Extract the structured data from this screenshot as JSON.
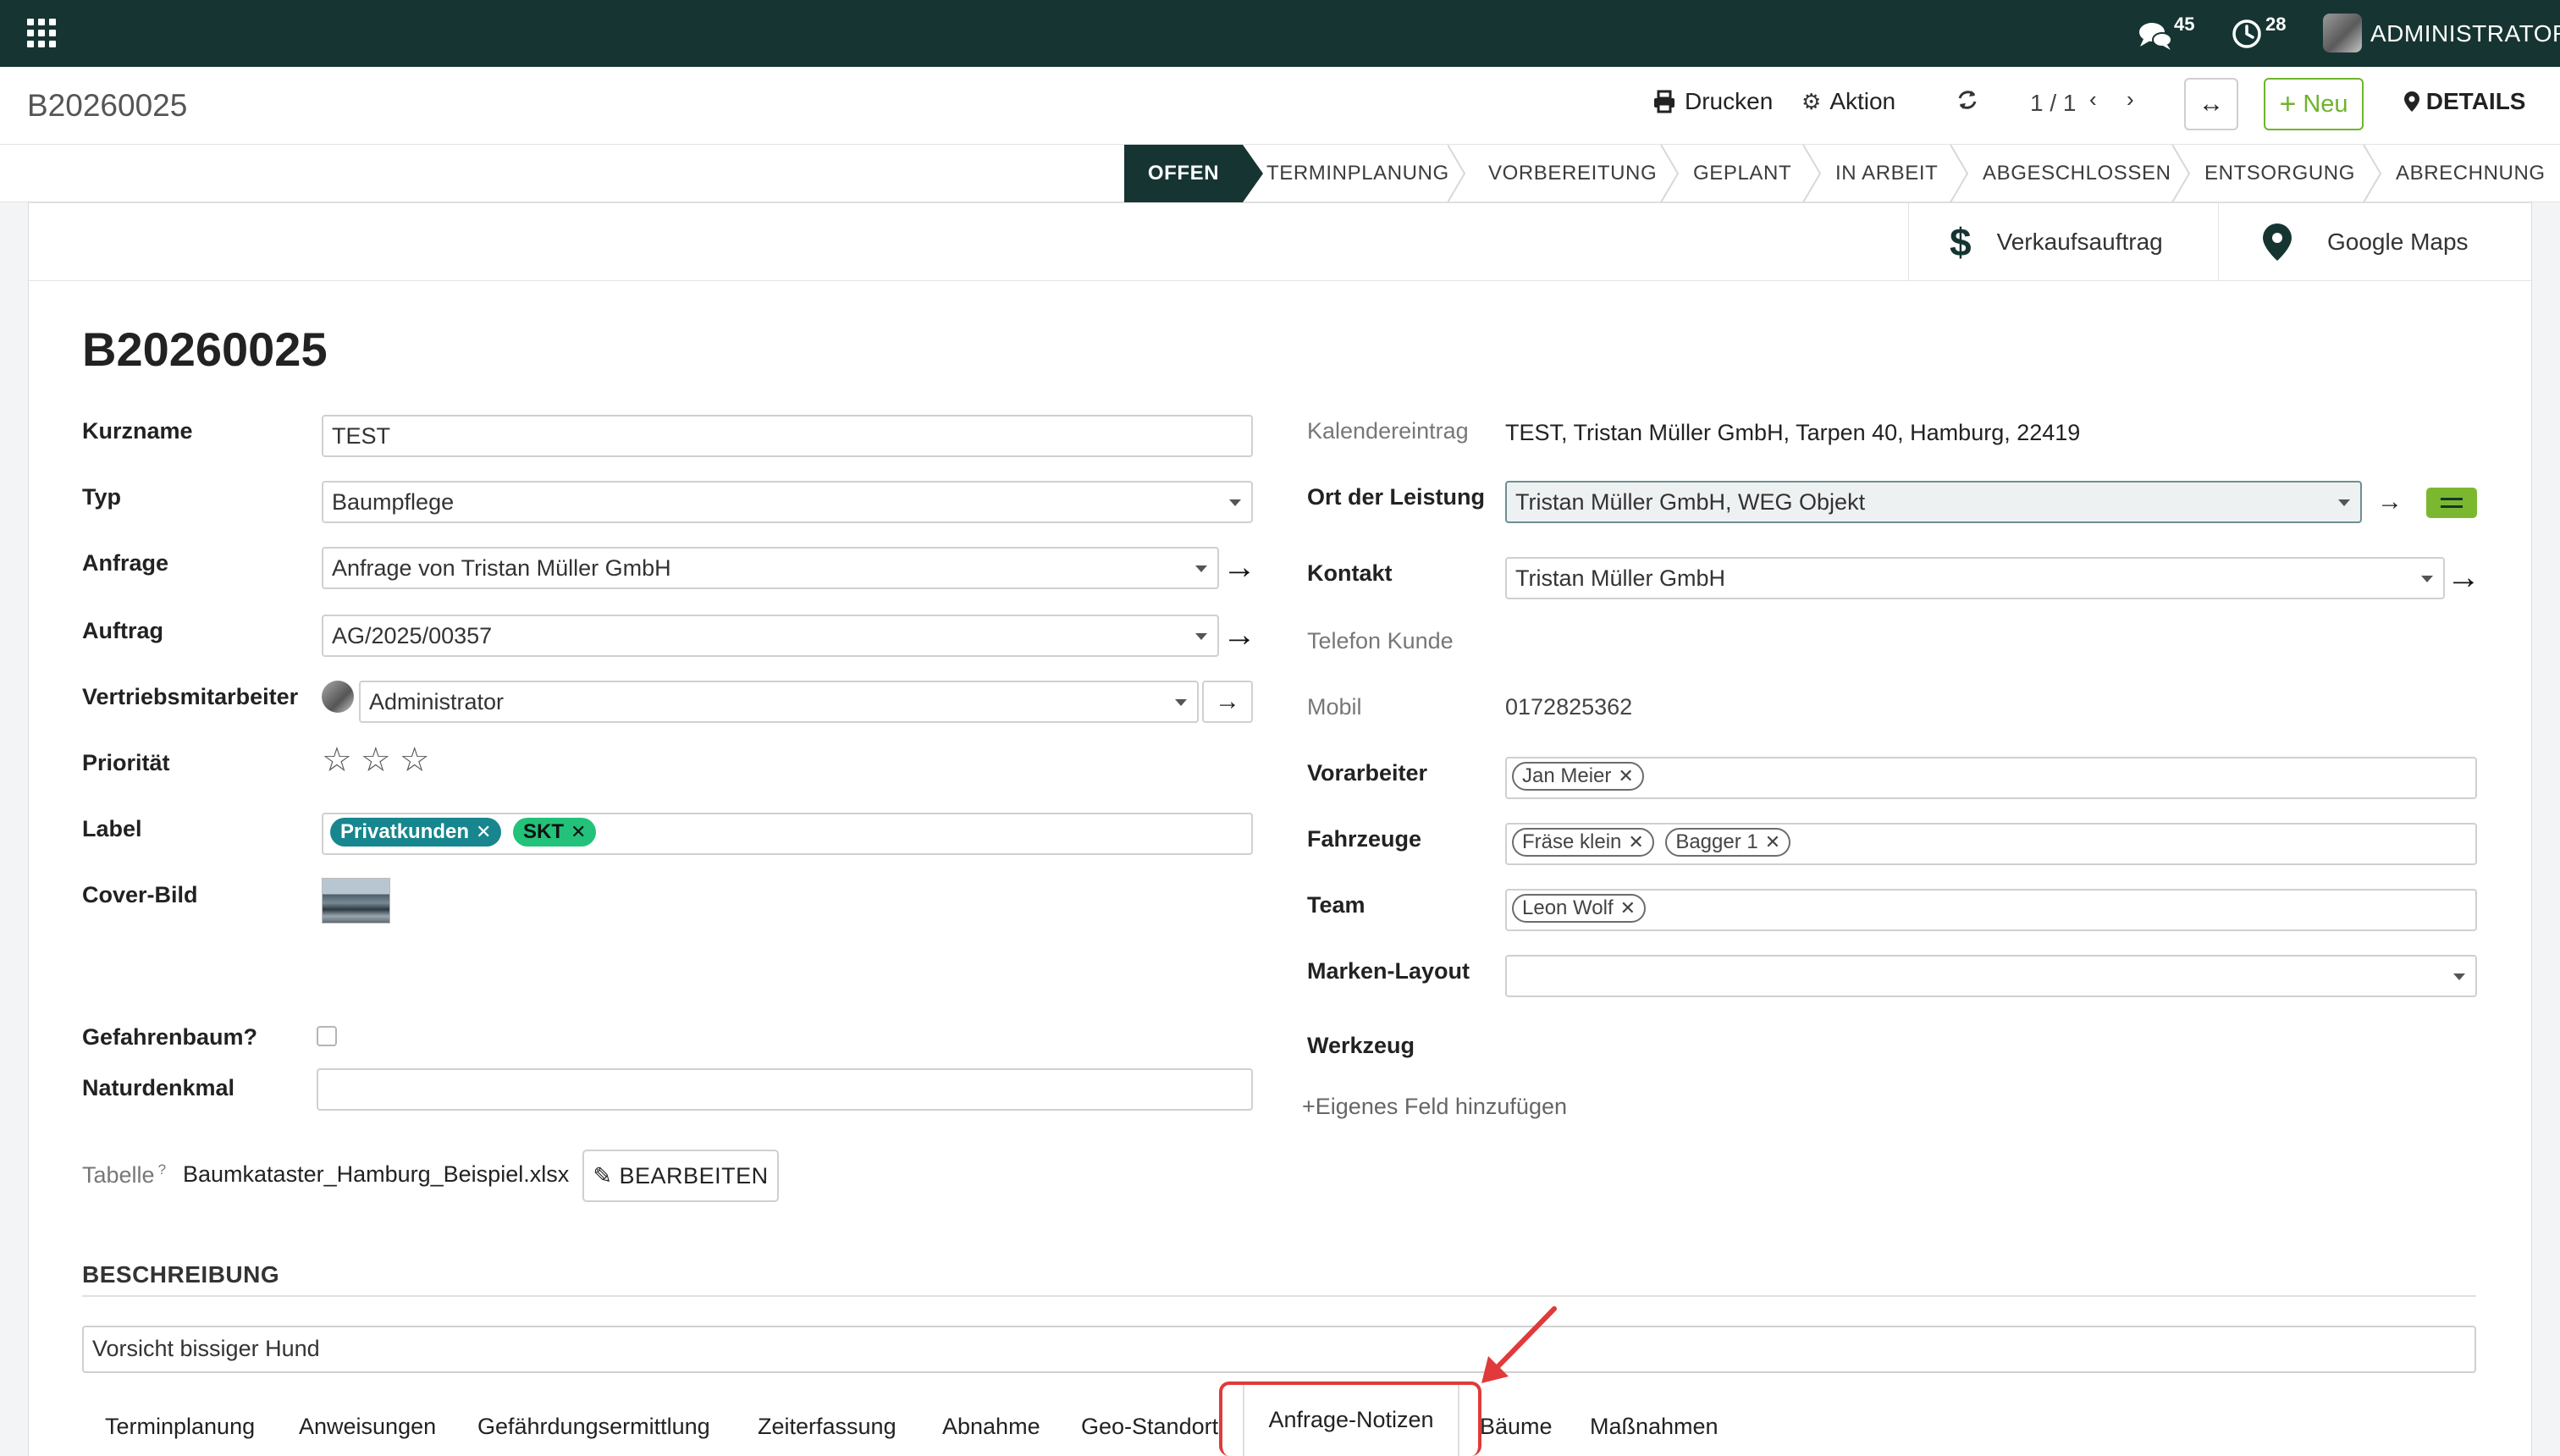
{
  "navbar": {
    "messages_count": "45",
    "activities_count": "28",
    "user_name": "ADMINISTRATOR"
  },
  "control_panel": {
    "record_name": "B20260025",
    "print_label": "Drucken",
    "action_label": "Aktion",
    "pager_value": "1 / 1",
    "new_label": "Neu",
    "details_label": "DETAILS"
  },
  "statusbar": {
    "stages": [
      "OFFEN",
      "TERMINPLANUNG",
      "VORBEREITUNG",
      "GEPLANT",
      "IN ARBEIT",
      "ABGESCHLOSSEN",
      "ENTSORGUNG",
      "ABRECHNUNG"
    ],
    "active_stage": "OFFEN"
  },
  "smart_buttons": {
    "sales_order_label": "Verkaufsauftrag",
    "google_maps_label": "Google Maps"
  },
  "form": {
    "title": "B20260025",
    "left": {
      "kurzname_label": "Kurzname",
      "kurzname_value": "TEST",
      "typ_label": "Typ",
      "typ_value": "Baumpflege",
      "anfrage_label": "Anfrage",
      "anfrage_value": "Anfrage von Tristan Müller GmbH",
      "auftrag_label": "Auftrag",
      "auftrag_value": "AG/2025/00357",
      "vertrieb_label": "Vertriebsmitarbeiter",
      "vertrieb_value": "Administrator",
      "prioritaet_label": "Priorität",
      "prioritaet_stars": 0,
      "label_label": "Label",
      "label_tags": [
        "Privatkunden",
        "SKT"
      ],
      "cover_label": "Cover-Bild",
      "gefahrenbaum_label": "Gefahrenbaum?",
      "gefahrenbaum_checked": false,
      "naturdenkmal_label": "Naturdenkmal",
      "naturdenkmal_value": "",
      "tabelle_label": "Tabelle",
      "tabelle_help": "?",
      "tabelle_value": "Baumkataster_Hamburg_Beispiel.xlsx",
      "bearbeiten_label": "BEARBEITEN"
    },
    "right": {
      "kalender_label": "Kalendereintrag",
      "kalender_value": "TEST, Tristan Müller GmbH, Tarpen 40, Hamburg, 22419",
      "ort_label": "Ort der Leistung",
      "ort_value": "Tristan Müller GmbH, WEG Objekt",
      "kontakt_label": "Kontakt",
      "kontakt_value": "Tristan Müller GmbH",
      "telefon_label": "Telefon Kunde",
      "telefon_value": "",
      "mobil_label": "Mobil",
      "mobil_value": "0172825362",
      "vorarbeiter_label": "Vorarbeiter",
      "vorarbeiter_tags": [
        "Jan Meier"
      ],
      "fahrzeuge_label": "Fahrzeuge",
      "fahrzeuge_tags": [
        "Fräse klein",
        "Bagger 1"
      ],
      "team_label": "Team",
      "team_tags": [
        "Leon Wolf"
      ],
      "marken_label": "Marken-Layout",
      "marken_value": "",
      "werkzeug_label": "Werkzeug",
      "add_field_label": "Eigenes Feld hinzufügen"
    },
    "beschreibung_title": "BESCHREIBUNG",
    "beschreibung_value": "Vorsicht bissiger Hund"
  },
  "notebook": {
    "tabs": [
      "Terminplanung",
      "Anweisungen",
      "Gefährdungsermittlung",
      "Zeiterfassung",
      "Abnahme",
      "Geo-Standort",
      "Anfrage-Notizen",
      "Bäume",
      "Maßnahmen"
    ],
    "active_tab": "Anfrage-Notizen"
  },
  "colors": {
    "navbar": "#163532",
    "accent_green": "#6fb42c",
    "tag_teal": "#17868e",
    "tag_green": "#23c27a",
    "annotation_red": "#e03a3a"
  }
}
